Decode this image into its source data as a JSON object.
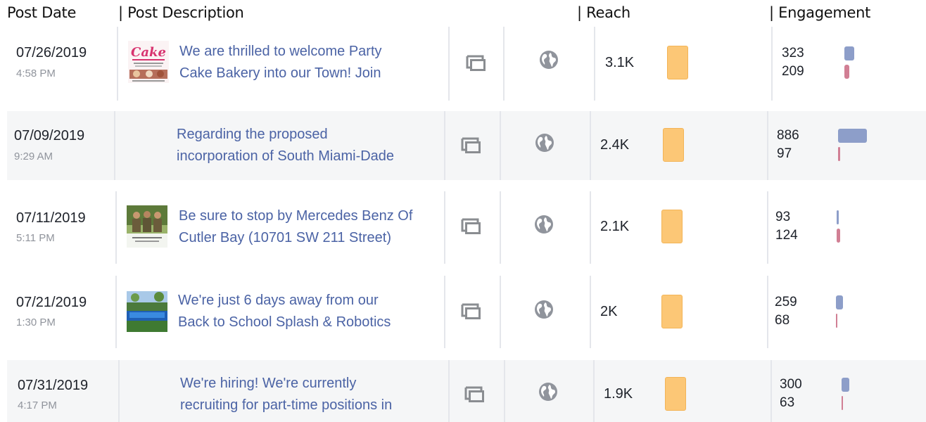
{
  "header": {
    "post_date": "Post Date",
    "post_description": "| Post Description",
    "reach": "| Reach",
    "engagement": "| Engagement"
  },
  "colors": {
    "link_text": "#4b63a5",
    "reach_bar": "#fcc776",
    "engagement_bar_primary": "#8d9ec9",
    "engagement_bar_secondary": "#d17f94",
    "row_shade": "#f5f6f7"
  },
  "icons": {
    "post_type": "album-icon",
    "audience": "globe-icon"
  },
  "posts": [
    {
      "date": "07/26/2019",
      "time": "4:58 PM",
      "has_thumbnail": true,
      "thumbnail": "cake-bakery-thumbnail",
      "thumbnail_text": "Cake",
      "desc_line1": "We are thrilled to welcome Party",
      "desc_line2": "Cake Bakery into our Town! Join",
      "reach": "3.1K",
      "eng_top": "323",
      "eng_bottom": "209"
    },
    {
      "date": "07/09/2019",
      "time": "9:29 AM",
      "has_thumbnail": false,
      "desc_line1": "Regarding the proposed",
      "desc_line2": "incorporation of South Miami-Dade",
      "reach": "2.4K",
      "eng_top": "886",
      "eng_bottom": "97"
    },
    {
      "date": "07/11/2019",
      "time": "5:11 PM",
      "has_thumbnail": true,
      "thumbnail": "people-group-thumbnail",
      "desc_line1": "Be sure to stop by Mercedes Benz Of",
      "desc_line2": "Cutler Bay (10701 SW 211 Street)",
      "reach": "2.1K",
      "eng_top": "93",
      "eng_bottom": "124"
    },
    {
      "date": "07/21/2019",
      "time": "1:30 PM",
      "has_thumbnail": true,
      "thumbnail": "splash-pool-thumbnail",
      "desc_line1": "We're just 6 days away from our",
      "desc_line2": "Back to School Splash & Robotics",
      "reach": "2K",
      "eng_top": "259",
      "eng_bottom": "68"
    },
    {
      "date": "07/31/2019",
      "time": "4:17 PM",
      "has_thumbnail": false,
      "desc_line1": "We're hiring! We're currently",
      "desc_line2": "recruiting for part-time positions in",
      "reach": "1.9K",
      "eng_top": "300",
      "eng_bottom": "63"
    }
  ]
}
